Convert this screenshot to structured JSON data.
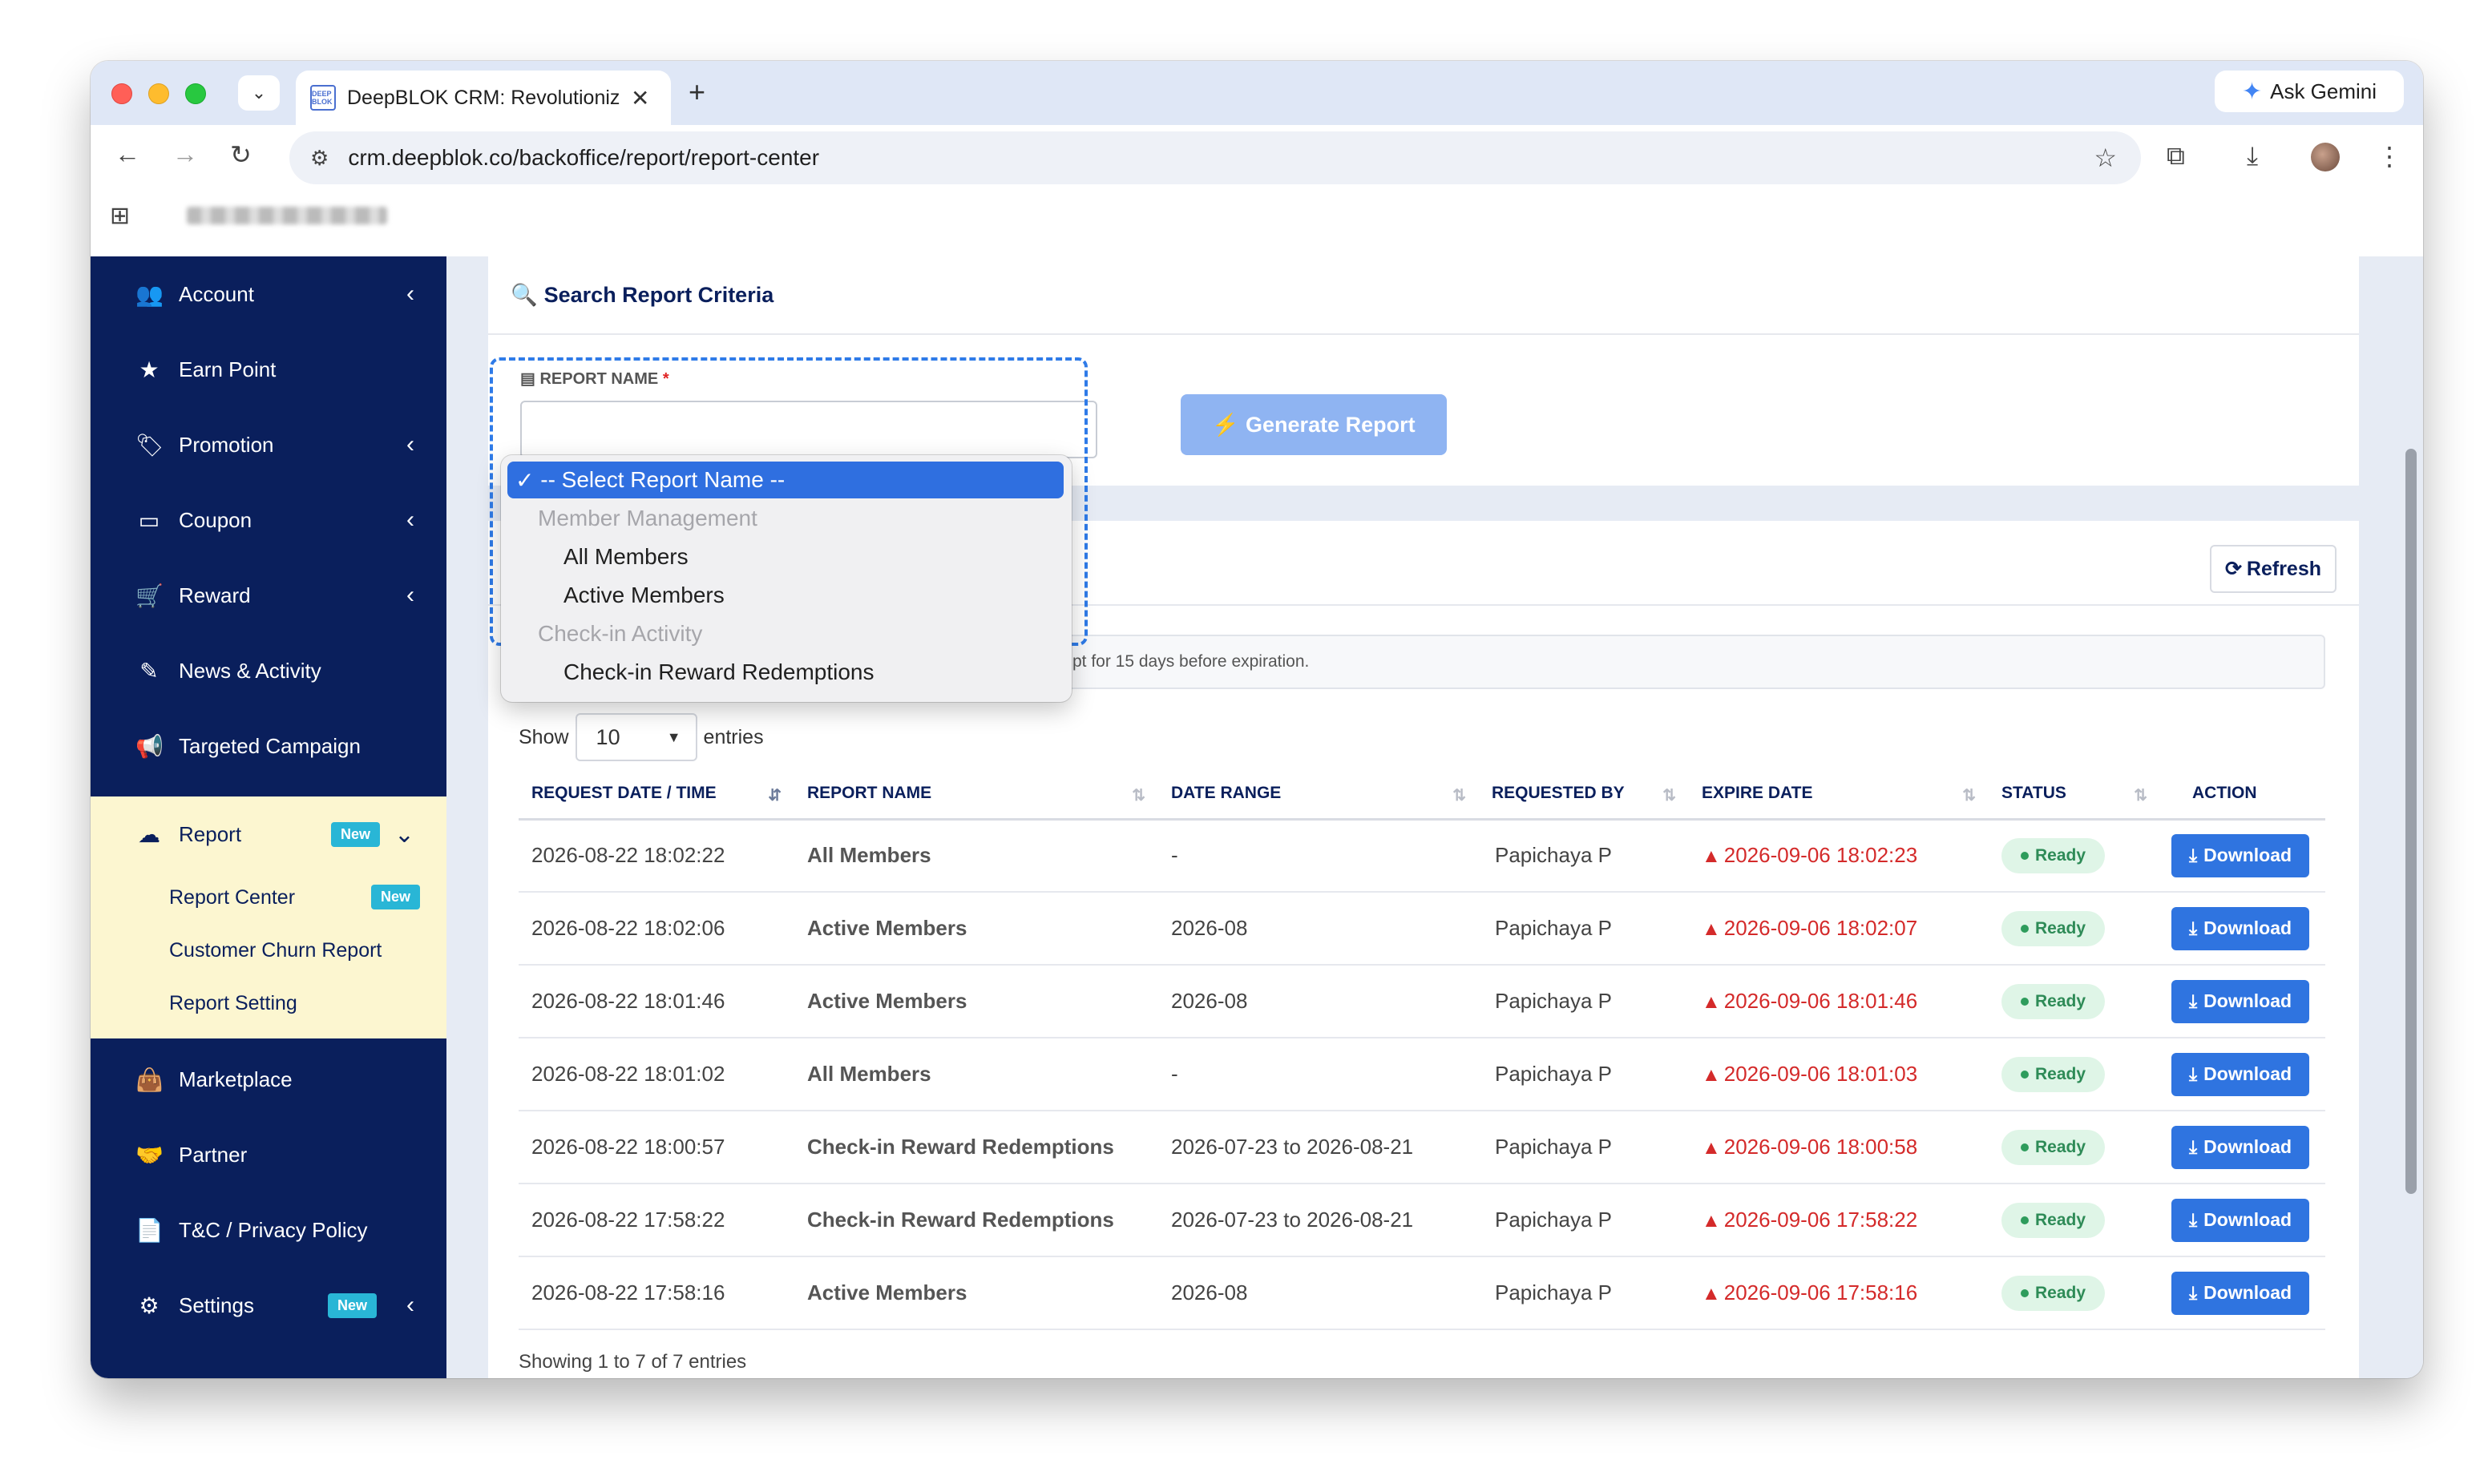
{
  "browser": {
    "tab_title": "DeepBLOK CRM: Revolutioniz",
    "favicon_text": "DEEP BLOK",
    "url": "crm.deepblok.co/backoffice/report/report-center",
    "gemini_label": "Ask Gemini"
  },
  "sidebar": {
    "items": [
      {
        "label": "Account",
        "icon": "users-icon"
      },
      {
        "label": "Earn Point",
        "icon": "star-icon"
      },
      {
        "label": "Promotion",
        "icon": "tag-icon"
      },
      {
        "label": "Coupon",
        "icon": "ticket-icon"
      },
      {
        "label": "Reward",
        "icon": "cart-icon"
      },
      {
        "label": "News & Activity",
        "icon": "edit-icon"
      },
      {
        "label": "Targeted Campaign",
        "icon": "megaphone-icon"
      }
    ],
    "report": {
      "label": "Report",
      "badge": "New",
      "sub_items": [
        {
          "label": "Report Center",
          "badge": "New"
        },
        {
          "label": "Customer Churn Report"
        },
        {
          "label": "Report Setting"
        }
      ]
    },
    "bottom_items": [
      {
        "label": "Marketplace"
      },
      {
        "label": "Partner"
      },
      {
        "label": "T&C / Privacy Policy"
      },
      {
        "label": "Settings",
        "badge": "New"
      }
    ]
  },
  "criteria": {
    "title": "Search Report Criteria",
    "report_name_label": "REPORT NAME",
    "required_mark": "*",
    "generate_label": "Generate Report",
    "dropdown": {
      "selected": "-- Select Report Name --",
      "groups": [
        {
          "label": "Member Management",
          "options": [
            "All Members",
            "Active Members"
          ]
        },
        {
          "label": "Check-in Activity",
          "options": [
            "Check-in Reward Redemptions"
          ]
        }
      ]
    }
  },
  "reports": {
    "refresh_label": "Refresh",
    "info_text": "Reports generated in the system will appear here. Reports will be kept for 15 days before expiration.",
    "show_label": "Show",
    "entries_value": "10",
    "entries_label": "entries",
    "columns": [
      "REQUEST DATE / TIME",
      "REPORT NAME",
      "DATE RANGE",
      "REQUESTED BY",
      "EXPIRE DATE",
      "STATUS",
      "ACTION"
    ],
    "rows": [
      {
        "date": "2026-08-22 18:02:22",
        "name": "All Members",
        "range": "-",
        "by": "Papichaya P",
        "expire": "2026-09-06 18:02:23",
        "status": "Ready",
        "action": "Download"
      },
      {
        "date": "2026-08-22 18:02:06",
        "name": "Active Members",
        "range": "2026-08",
        "by": "Papichaya P",
        "expire": "2026-09-06 18:02:07",
        "status": "Ready",
        "action": "Download"
      },
      {
        "date": "2026-08-22 18:01:46",
        "name": "Active Members",
        "range": "2026-08",
        "by": "Papichaya P",
        "expire": "2026-09-06 18:01:46",
        "status": "Ready",
        "action": "Download"
      },
      {
        "date": "2026-08-22 18:01:02",
        "name": "All Members",
        "range": "-",
        "by": "Papichaya P",
        "expire": "2026-09-06 18:01:03",
        "status": "Ready",
        "action": "Download"
      },
      {
        "date": "2026-08-22 18:00:57",
        "name": "Check-in Reward Redemptions",
        "range": "2026-07-23 to 2026-08-21",
        "by": "Papichaya P",
        "expire": "2026-09-06 18:00:58",
        "status": "Ready",
        "action": "Download"
      },
      {
        "date": "2026-08-22 17:58:22",
        "name": "Check-in Reward Redemptions",
        "range": "2026-07-23 to 2026-08-21",
        "by": "Papichaya P",
        "expire": "2026-09-06 17:58:22",
        "status": "Ready",
        "action": "Download"
      },
      {
        "date": "2026-08-22 17:58:16",
        "name": "Active Members",
        "range": "2026-08",
        "by": "Papichaya P",
        "expire": "2026-09-06 17:58:16",
        "status": "Ready",
        "action": "Download"
      }
    ],
    "showing_text": "Showing 1 to 7 of 7 entries"
  },
  "colors": {
    "sidebar_bg": "#0a1f5c",
    "report_section_bg": "#fcf6d0",
    "primary_button": "#2f74e0",
    "expire_text": "#d42a2a",
    "status_ready_bg": "#dff5e7"
  }
}
